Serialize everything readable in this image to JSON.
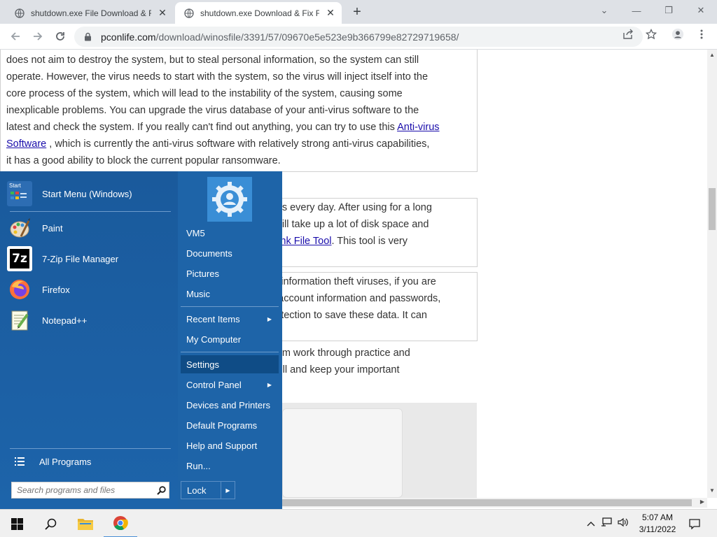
{
  "browser": {
    "tabs": [
      {
        "title": "shutdown.exe File Download & F",
        "active": false
      },
      {
        "title": "shutdown.exe Download & Fix Fi",
        "active": true
      }
    ],
    "url_host": "pconlife.com",
    "url_path": "/download/winosfile/3391/57/09670e5e523e9b366799e82729719658/"
  },
  "content": {
    "box1": {
      "line0": "does not aim to destroy the system, but to steal personal information, so the system can still",
      "line1": "operate. However, the virus needs to start with the system, so the virus will inject itself into the",
      "line2": "core process of the system, which will lead to the instability of the system, causing some",
      "line3": "inexplicable problems. You can upgrade the virus database of your anti-virus software to the",
      "line4a": "latest and check the system. If you really can't find out anything, you can try to use this ",
      "link1a": "Anti-virus",
      "link1b": "Software",
      "line5b": " , which is currently the anti-virus software with relatively strong anti-virus capabilities,",
      "line6": "it has a good ability to block the current popular ransomware."
    },
    "box2": {
      "line0": "y files every day. After using for a long",
      "line1": "es will take up a lot of disk space and",
      "link": "e Junk File Tool",
      "line2b": ". This tool is very"
    },
    "box3": {
      "line0": "and information theft viruses, if you are",
      "line1": "ant account information and passwords,",
      "line2": "l protection to save these data. It can"
    },
    "para4": {
      "line0": "g-term work through practice and",
      "line1": "n well and keep your important"
    }
  },
  "start_menu": {
    "programs": [
      {
        "label": "Start Menu (Windows)",
        "icon": "start-menu-icon"
      },
      {
        "label": "Paint",
        "icon": "paint-icon"
      },
      {
        "label": "7-Zip File Manager",
        "icon": "7zip-icon"
      },
      {
        "label": "Firefox",
        "icon": "firefox-icon"
      },
      {
        "label": "Notepad++",
        "icon": "notepadpp-icon"
      }
    ],
    "start_icon_text": "Start",
    "sevenzip_text": "7z",
    "all_programs": "All Programs",
    "search_placeholder": "Search programs and files",
    "right": {
      "user": "VM5",
      "documents": "Documents",
      "pictures": "Pictures",
      "music": "Music",
      "recent_items": "Recent Items",
      "my_computer": "My Computer",
      "settings": "Settings",
      "control_panel": "Control Panel",
      "devices_printers": "Devices and Printers",
      "default_programs": "Default Programs",
      "help_support": "Help and Support",
      "run": "Run..."
    },
    "lock": "Lock"
  },
  "taskbar": {
    "time": "5:07 AM",
    "date": "3/11/2022"
  },
  "colors": {
    "start_menu_bg": "#1c5fa1",
    "highlight": "#0f4c86",
    "link": "#1a0dab"
  }
}
